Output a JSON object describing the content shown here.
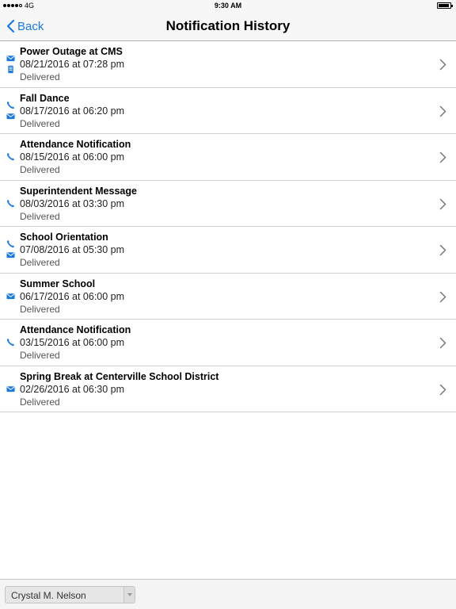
{
  "status_bar": {
    "carrier": "4G",
    "time": "9:30 AM",
    "battery_level": 0.95
  },
  "nav": {
    "back_label": "Back",
    "title": "Notification History"
  },
  "colors": {
    "accent": "#1a7ae0",
    "separator": "#d0d0d0"
  },
  "notifications": [
    {
      "title": "Power Outage at CMS",
      "datetime": "08/21/2016 at 07:28 pm",
      "status": "Delivered",
      "channels": [
        "email-icon",
        "sms-icon"
      ]
    },
    {
      "title": "Fall Dance",
      "datetime": "08/17/2016 at 06:20 pm",
      "status": "Delivered",
      "channels": [
        "phone-icon",
        "email-icon"
      ]
    },
    {
      "title": "Attendance Notification",
      "datetime": "08/15/2016 at 06:00 pm",
      "status": "Delivered",
      "channels": [
        "phone-icon"
      ]
    },
    {
      "title": "Superintendent Message",
      "datetime": "08/03/2016 at 03:30 pm",
      "status": "Delivered",
      "channels": [
        "phone-icon"
      ]
    },
    {
      "title": "School Orientation",
      "datetime": "07/08/2016 at 05:30 pm",
      "status": "Delivered",
      "channels": [
        "phone-icon",
        "email-icon"
      ]
    },
    {
      "title": "Summer School",
      "datetime": "06/17/2016 at 06:00 pm",
      "status": "Delivered",
      "channels": [
        "email-icon"
      ]
    },
    {
      "title": "Attendance Notification",
      "datetime": "03/15/2016 at 06:00 pm",
      "status": "Delivered",
      "channels": [
        "phone-icon"
      ]
    },
    {
      "title": "Spring Break at Centerville School District",
      "datetime": "02/26/2016 at 06:30 pm",
      "status": "Delivered",
      "channels": [
        "email-icon"
      ]
    }
  ],
  "footer": {
    "selected_user": "Crystal M. Nelson"
  }
}
